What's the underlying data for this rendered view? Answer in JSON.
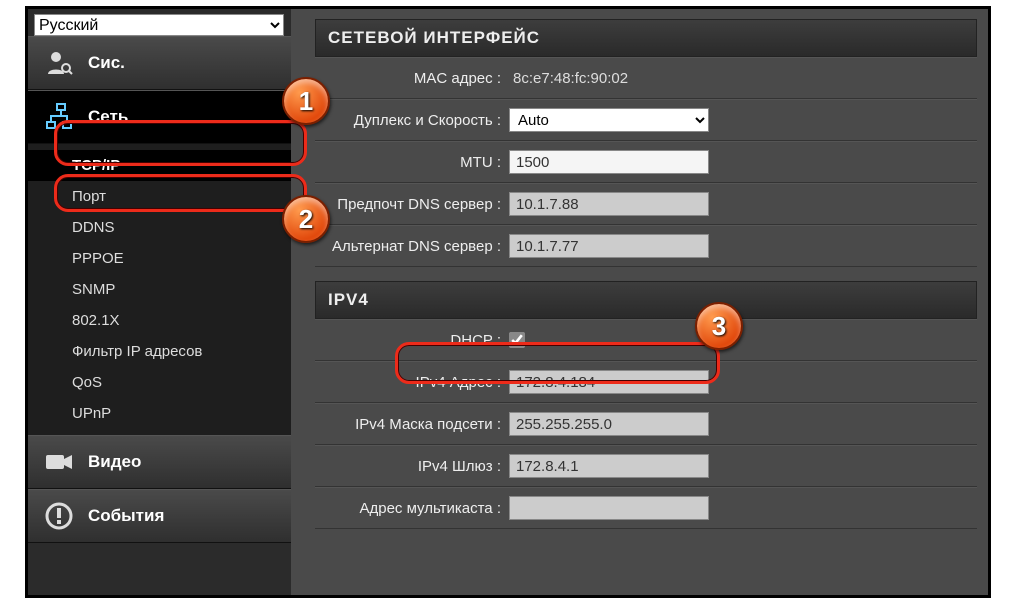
{
  "language": {
    "selected": "Русский"
  },
  "sidebar": {
    "items": [
      {
        "label": "Сис."
      },
      {
        "label": "Сеть"
      },
      {
        "label": "Видео"
      },
      {
        "label": "События"
      }
    ],
    "network_sub": [
      "TCP/IP",
      "Порт",
      "DDNS",
      "PPPOE",
      "SNMP",
      "802.1X",
      "Фильтр IP адресов",
      "QoS",
      "UPnP"
    ]
  },
  "main": {
    "section1_title": "СЕТЕВОЙ ИНТЕРФЕЙС",
    "mac_label": "MAC адрес :",
    "mac_value": "8c:e7:48:fc:90:02",
    "duplex_label": "Дуплекс и Скорость :",
    "duplex_value": "Auto",
    "mtu_label": "MTU :",
    "mtu_value": "1500",
    "dns1_label": "Предпочт DNS сервер :",
    "dns1_value": "10.1.7.88",
    "dns2_label": "Альтернат DNS сервер :",
    "dns2_value": "10.1.7.77",
    "section2_title": "IPV4",
    "dhcp_label": "DHCP :",
    "dhcp_checked": true,
    "ipv4addr_label": "IPv4 Адрес :",
    "ipv4addr_value": "172.8.4.184",
    "ipv4mask_label": "IPv4 Маска подсети :",
    "ipv4mask_value": "255.255.255.0",
    "ipv4gw_label": "IPv4 Шлюз :",
    "ipv4gw_value": "172.8.4.1",
    "multicast_label": "Адрес мультикаста :",
    "multicast_value": ""
  },
  "callouts": {
    "c1": "1",
    "c2": "2",
    "c3": "3"
  }
}
